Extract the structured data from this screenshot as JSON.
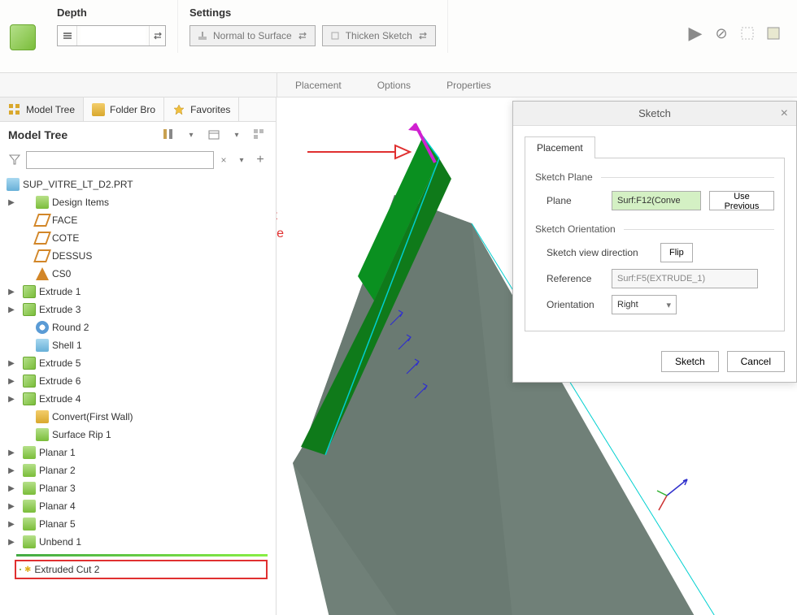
{
  "toolbar": {
    "depth_label": "Depth",
    "settings_label": "Settings",
    "normal_to_surface": "Normal to Surface",
    "thicken_sketch": "Thicken Sketch"
  },
  "subtabs": {
    "placement": "Placement",
    "options": "Options",
    "properties": "Properties"
  },
  "panel": {
    "tab_model_tree": "Model Tree",
    "tab_folder": "Folder Bro",
    "tab_favorites": "Favorites",
    "title": "Model Tree",
    "filter_placeholder": ""
  },
  "tree": {
    "root": "SUP_VITRE_LT_D2.PRT",
    "items": [
      {
        "label": "Design Items",
        "icon": "ic-folder",
        "exp": "▶",
        "indent": 1
      },
      {
        "label": "FACE",
        "icon": "ic-datum",
        "exp": "",
        "indent": 1
      },
      {
        "label": "COTE",
        "icon": "ic-datum",
        "exp": "",
        "indent": 1
      },
      {
        "label": "DESSUS",
        "icon": "ic-datum",
        "exp": "",
        "indent": 1
      },
      {
        "label": "CS0",
        "icon": "ic-csys",
        "exp": "",
        "indent": 1
      },
      {
        "label": "Extrude 1",
        "icon": "ic-ext",
        "exp": "▶",
        "indent": 0
      },
      {
        "label": "Extrude 3",
        "icon": "ic-ext",
        "exp": "▶",
        "indent": 0
      },
      {
        "label": "Round 2",
        "icon": "ic-round",
        "exp": "",
        "indent": 1
      },
      {
        "label": "Shell 1",
        "icon": "ic-shell",
        "exp": "",
        "indent": 1
      },
      {
        "label": "Extrude 5",
        "icon": "ic-ext",
        "exp": "▶",
        "indent": 0
      },
      {
        "label": "Extrude 6",
        "icon": "ic-ext",
        "exp": "▶",
        "indent": 0
      },
      {
        "label": "Extrude 4",
        "icon": "ic-ext",
        "exp": "▶",
        "indent": 0
      },
      {
        "label": "Convert(First Wall)",
        "icon": "ic-conv",
        "exp": "",
        "indent": 1
      },
      {
        "label": "Surface Rip 1",
        "icon": "ic-rip",
        "exp": "",
        "indent": 1
      },
      {
        "label": "Planar 1",
        "icon": "ic-planar",
        "exp": "▶",
        "indent": 0
      },
      {
        "label": "Planar 2",
        "icon": "ic-planar",
        "exp": "▶",
        "indent": 0
      },
      {
        "label": "Planar 3",
        "icon": "ic-planar",
        "exp": "▶",
        "indent": 0
      },
      {
        "label": "Planar 4",
        "icon": "ic-planar",
        "exp": "▶",
        "indent": 0
      },
      {
        "label": "Planar 5",
        "icon": "ic-planar",
        "exp": "▶",
        "indent": 0
      },
      {
        "label": "Unbend 1",
        "icon": "ic-unbend",
        "exp": "▶",
        "indent": 0
      }
    ],
    "current": "Extruded Cut 2"
  },
  "annotation": {
    "line1": "cut direction is not",
    "line2": "normal to the plane"
  },
  "dialog": {
    "title": "Sketch",
    "tab": "Placement",
    "group1": "Sketch Plane",
    "plane_label": "Plane",
    "plane_value": "Surf:F12(Conve",
    "use_previous": "Use Previous",
    "group2": "Sketch Orientation",
    "view_dir_label": "Sketch view direction",
    "flip": "Flip",
    "reference_label": "Reference",
    "reference_value": "Surf:F5(EXTRUDE_1)",
    "orientation_label": "Orientation",
    "orientation_value": "Right",
    "btn_sketch": "Sketch",
    "btn_cancel": "Cancel"
  }
}
